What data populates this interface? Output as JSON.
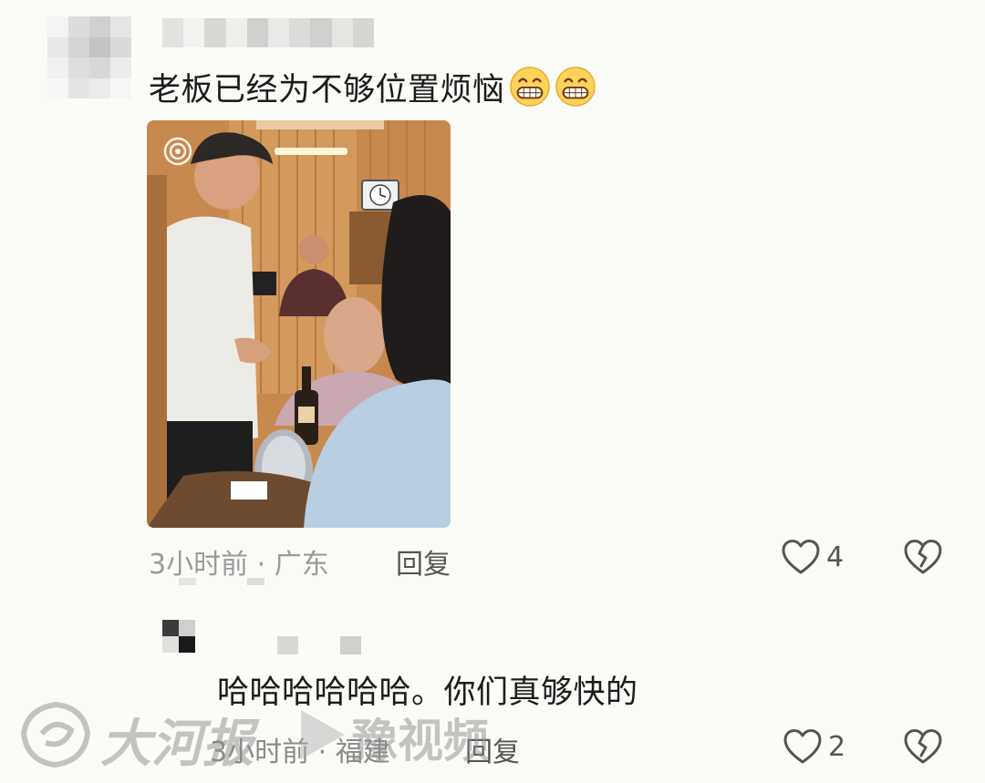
{
  "comments": [
    {
      "text": "老板已经为不够位置烦恼",
      "emojis": [
        "grinning-face-emoji",
        "grinning-face-emoji"
      ],
      "meta": "3小时前 · 广东",
      "reply_label": "回复",
      "likes": "4"
    },
    {
      "text": "哈哈哈哈哈哈。你们真够快的",
      "meta": "3小时前 · 福建",
      "reply_label": "回复",
      "likes": "2"
    }
  ],
  "watermark": {
    "brand_left": "大河报",
    "brand_right": "豫视频"
  },
  "colors": {
    "background": "#fbfbf8",
    "meta_text": "#9a9a9a",
    "icon": "#555555"
  }
}
